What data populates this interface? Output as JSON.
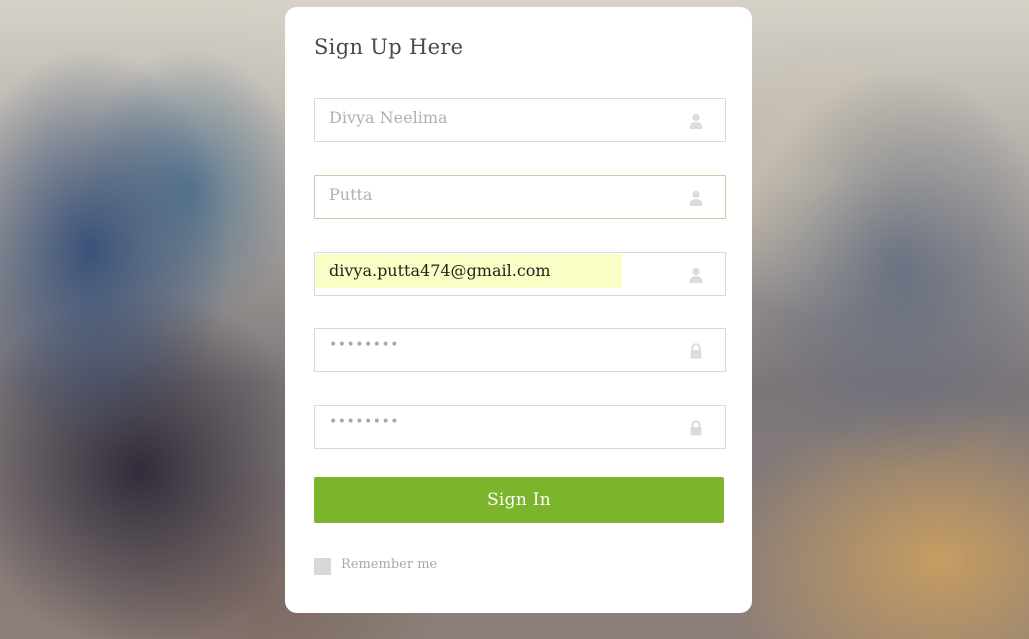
{
  "form": {
    "title": "Sign Up Here",
    "fields": [
      {
        "value": "Divya Neelima",
        "icon": "user-icon"
      },
      {
        "value": "Putta",
        "icon": "user-icon"
      },
      {
        "value": "divya.putta474@gmail.com",
        "icon": "user-icon"
      },
      {
        "value": "••••••••",
        "icon": "lock-icon"
      },
      {
        "value": "••••••••",
        "icon": "lock-icon"
      }
    ],
    "submit_label": "Sign In",
    "remember_label": "Remember me"
  },
  "colors": {
    "button": "#7cb42b",
    "autofill": "#fafdc4",
    "card": "#ffffff"
  }
}
